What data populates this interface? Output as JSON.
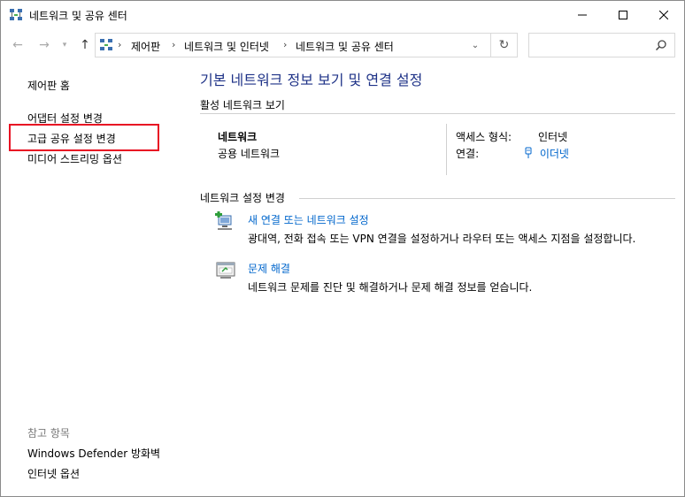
{
  "window": {
    "title": "네트워크 및 공유 센터"
  },
  "address": {
    "crumbs": [
      "제어판",
      "네트워크 및 인터넷",
      "네트워크 및 공유 센터"
    ],
    "search_placeholder": ""
  },
  "left": {
    "home": "제어판 홈",
    "links": [
      "어댑터 설정 변경",
      "고급 공유 설정 변경",
      "미디어 스트리밍 옵션"
    ],
    "see_also_title": "참고 항목",
    "see_also": [
      "Windows Defender 방화벽",
      "인터넷 옵션"
    ]
  },
  "main": {
    "title": "기본 네트워크 정보 보기 및 연결 설정",
    "active_header": "활성 네트워크 보기",
    "network": {
      "name": "네트워크",
      "type": "공용 네트워크",
      "access_label": "액세스 형식:",
      "access_value": "인터넷",
      "connection_label": "연결:",
      "connection_value": "이더넷"
    },
    "change_header": "네트워크 설정 변경",
    "tasks": [
      {
        "icon": "new-connection-icon",
        "title": "새 연결 또는 네트워크 설정",
        "desc": "광대역, 전화 접속 또는 VPN 연결을 설정하거나 라우터 또는 액세스 지점을 설정합니다."
      },
      {
        "icon": "troubleshoot-icon",
        "title": "문제 해결",
        "desc": "네트워크 문제를 진단 및 해결하거나 문제 해결 정보를 얻습니다."
      }
    ]
  },
  "colors": {
    "link": "#0066cc",
    "title": "#1e3287",
    "highlight": "#e81123"
  }
}
